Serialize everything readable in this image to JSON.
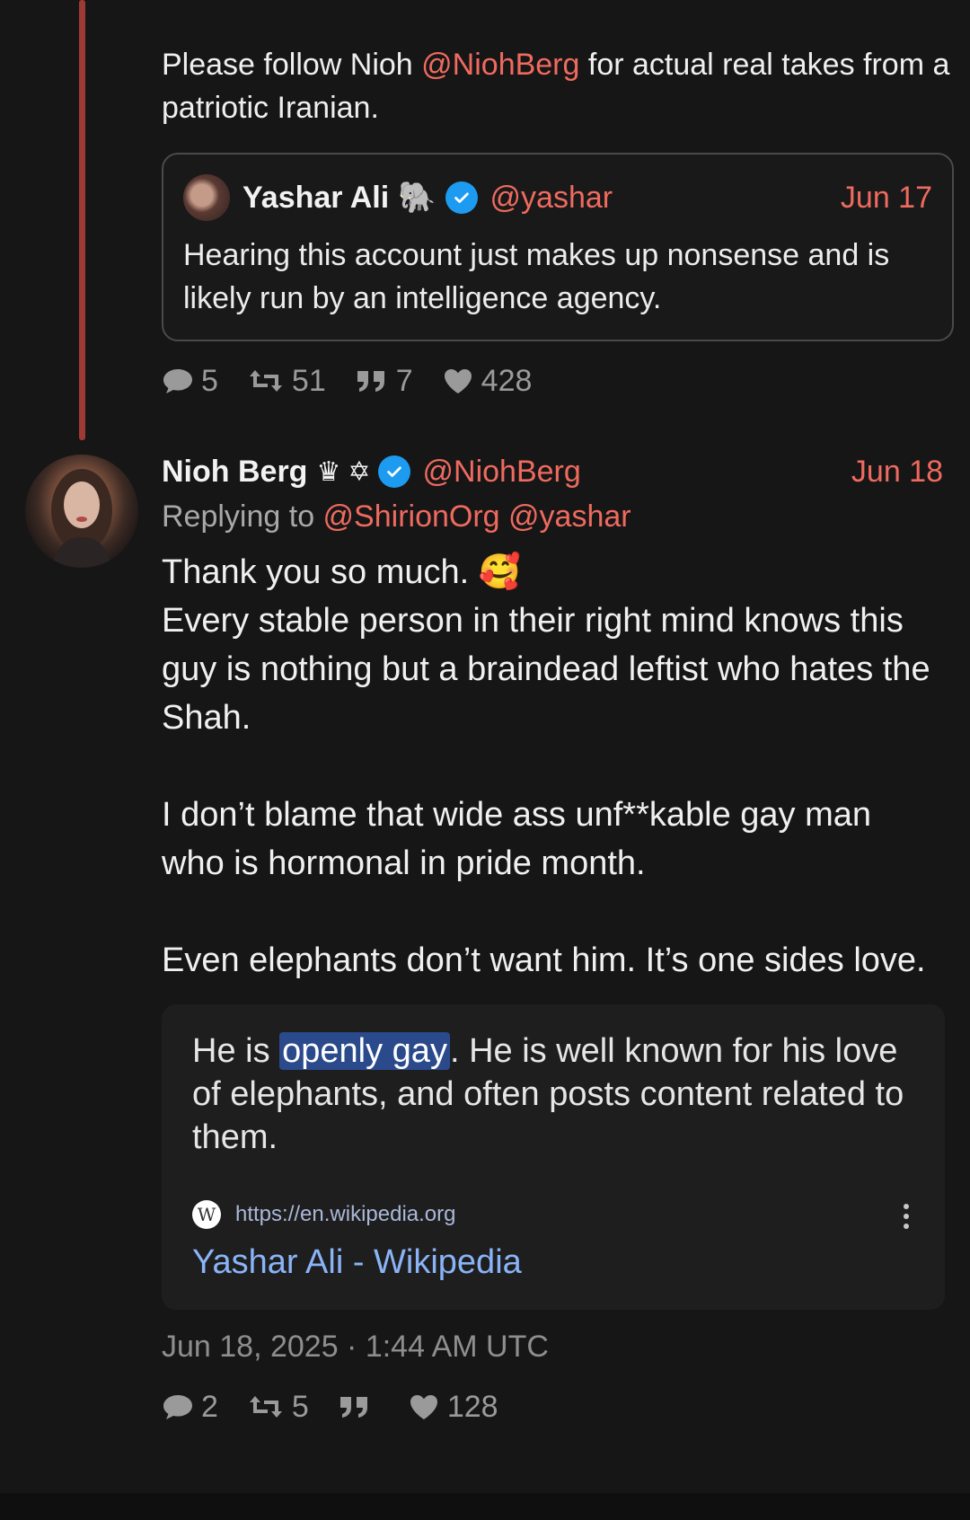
{
  "thread": {
    "tweet1": {
      "text_before": "Please follow Nioh ",
      "mention": "@NiohBerg",
      "text_after": " for actual real takes from a patriotic Iranian.",
      "quote": {
        "name": "Yashar Ali",
        "name_emoji": "🐘",
        "handle": "@yashar",
        "date": "Jun 17",
        "text": "Hearing this account just makes up nonsense and is likely run by an intelligence agency."
      },
      "stats": {
        "replies": "5",
        "retweets": "51",
        "quotes": "7",
        "likes": "428"
      }
    },
    "tweet2": {
      "name": "Nioh Berg",
      "badge1": "♛",
      "badge2": "✡",
      "handle": "@NiohBerg",
      "date": "Jun 18",
      "replying_label": "Replying to ",
      "replying_to_1": "@ShirionOrg",
      "replying_to_2": "@yashar",
      "body": {
        "line1": "Thank you so much. 🥰",
        "p1": "Every stable person in their right mind knows this guy is nothing but a braindead leftist who hates the Shah.",
        "p2": "I don’t blame that wide ass unf**kable gay man who is hormonal in pride month.",
        "p3": "Even elephants don’t want him. It’s one sides love."
      },
      "embed": {
        "text_before": "He is ",
        "highlight": "openly gay",
        "text_after": ". He is well known for his love of elephants, and often posts content related to them.",
        "source_icon": "W",
        "url": "https://en.wikipedia.org",
        "title": "Yashar Ali - Wikipedia"
      },
      "timestamp": "Jun 18, 2025 · 1:44 AM UTC",
      "stats": {
        "replies": "2",
        "retweets": "5",
        "quotes": "",
        "likes": "128"
      }
    }
  },
  "colors": {
    "background": "#161616",
    "accent": "#ef6a5f",
    "thread_line": "#9e3a36",
    "verified": "#1d9bf0",
    "link": "#8ab4f8"
  },
  "icons": [
    "comment-icon",
    "retweet-icon",
    "quote-icon",
    "heart-icon",
    "verified-icon",
    "wikipedia-icon",
    "more-vert-icon"
  ]
}
